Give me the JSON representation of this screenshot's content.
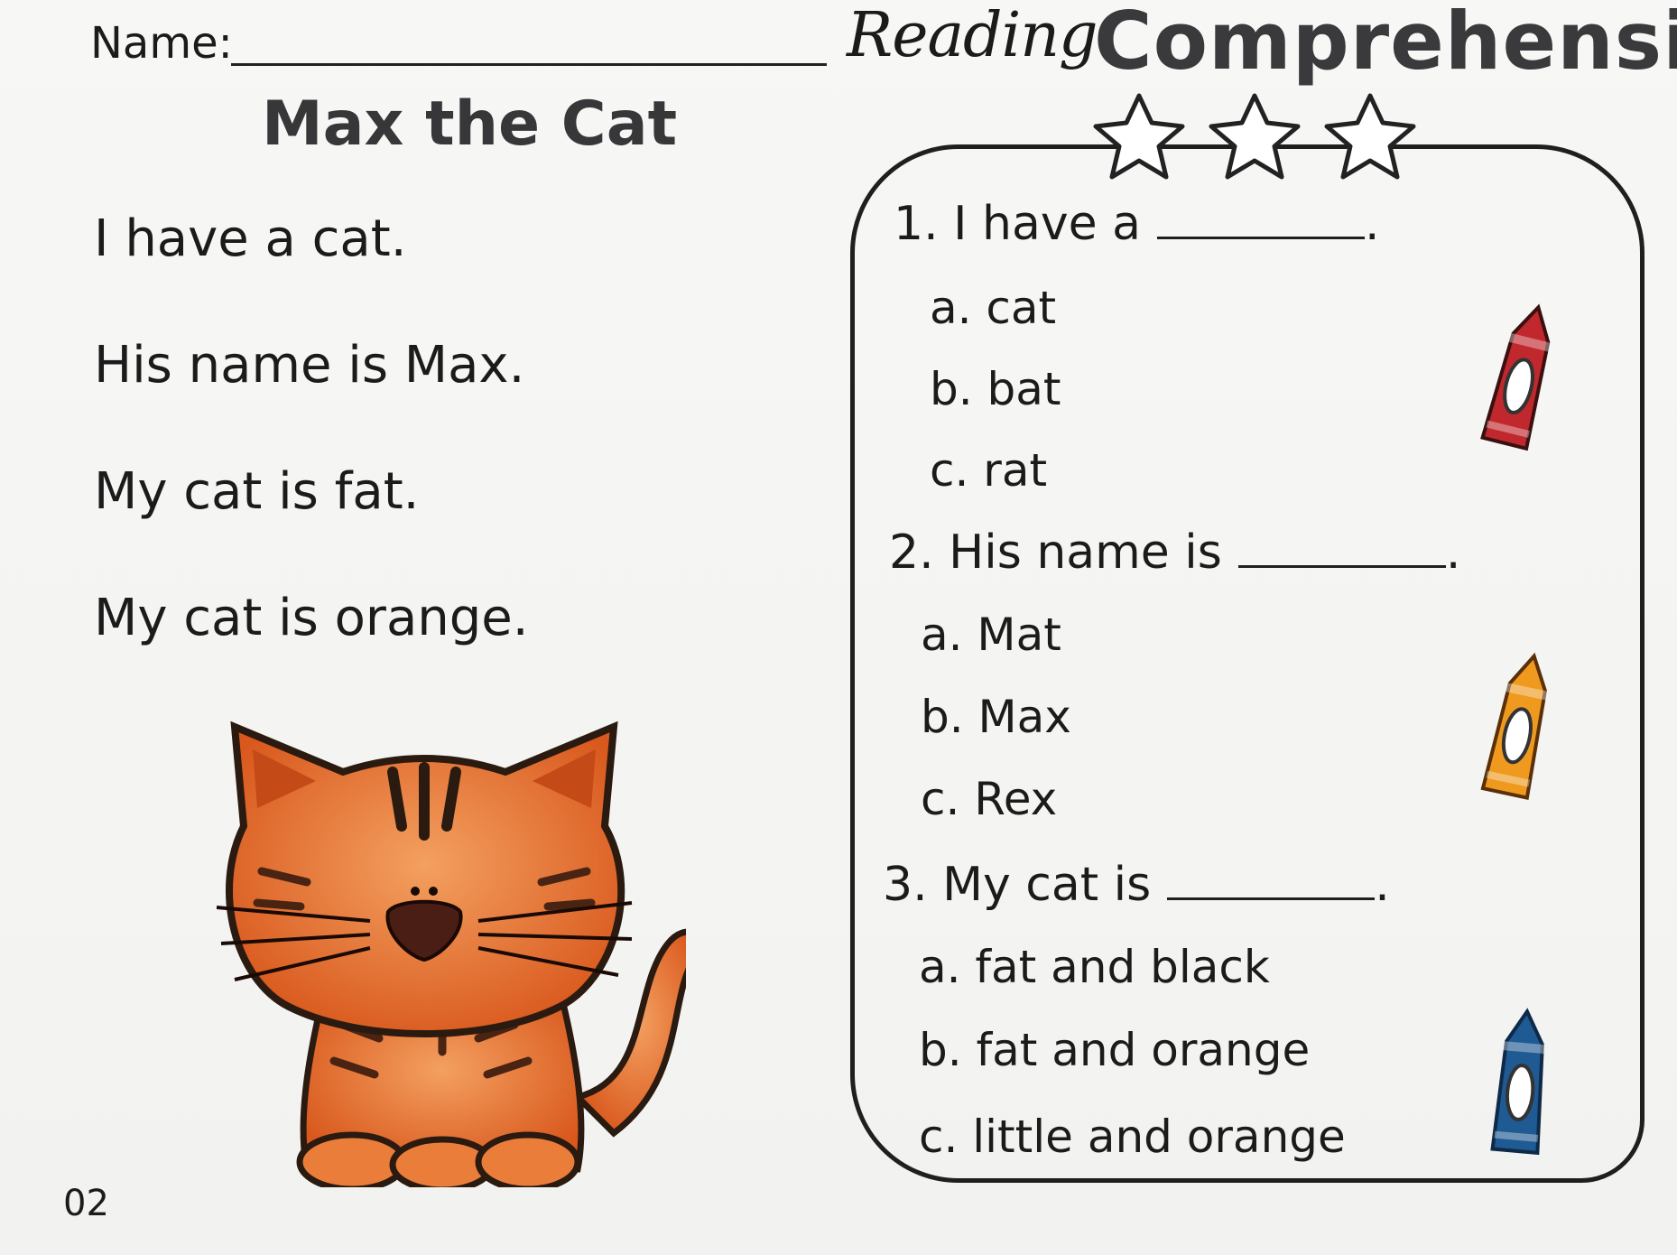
{
  "header": {
    "name_label": "Name:",
    "title_reading": "Reading",
    "title_comprehension": "Comprehension"
  },
  "story": {
    "title": "Max the Cat",
    "lines": [
      "I have a cat.",
      "His name is Max.",
      "My cat is fat.",
      "My cat is orange."
    ]
  },
  "questions": [
    {
      "prompt": "1. I have a",
      "end": ".",
      "options": [
        "a. cat",
        "b. bat",
        "c. rat"
      ]
    },
    {
      "prompt": "2. His name is",
      "end": ".",
      "options": [
        "a. Mat",
        "b. Max",
        "c. Rex"
      ]
    },
    {
      "prompt": "3. My cat is",
      "end": ".",
      "options": [
        "a. fat and black",
        "b. fat and orange",
        "c. little and orange"
      ]
    }
  ],
  "page_number": "02",
  "crayon_colors": {
    "q1": "#c0282d",
    "q2": "#ef9a1f",
    "q3": "#1f5a93"
  },
  "cat_color": "#e8702a",
  "icons": [
    "star-icon",
    "crayon-icon",
    "cat-illustration"
  ]
}
